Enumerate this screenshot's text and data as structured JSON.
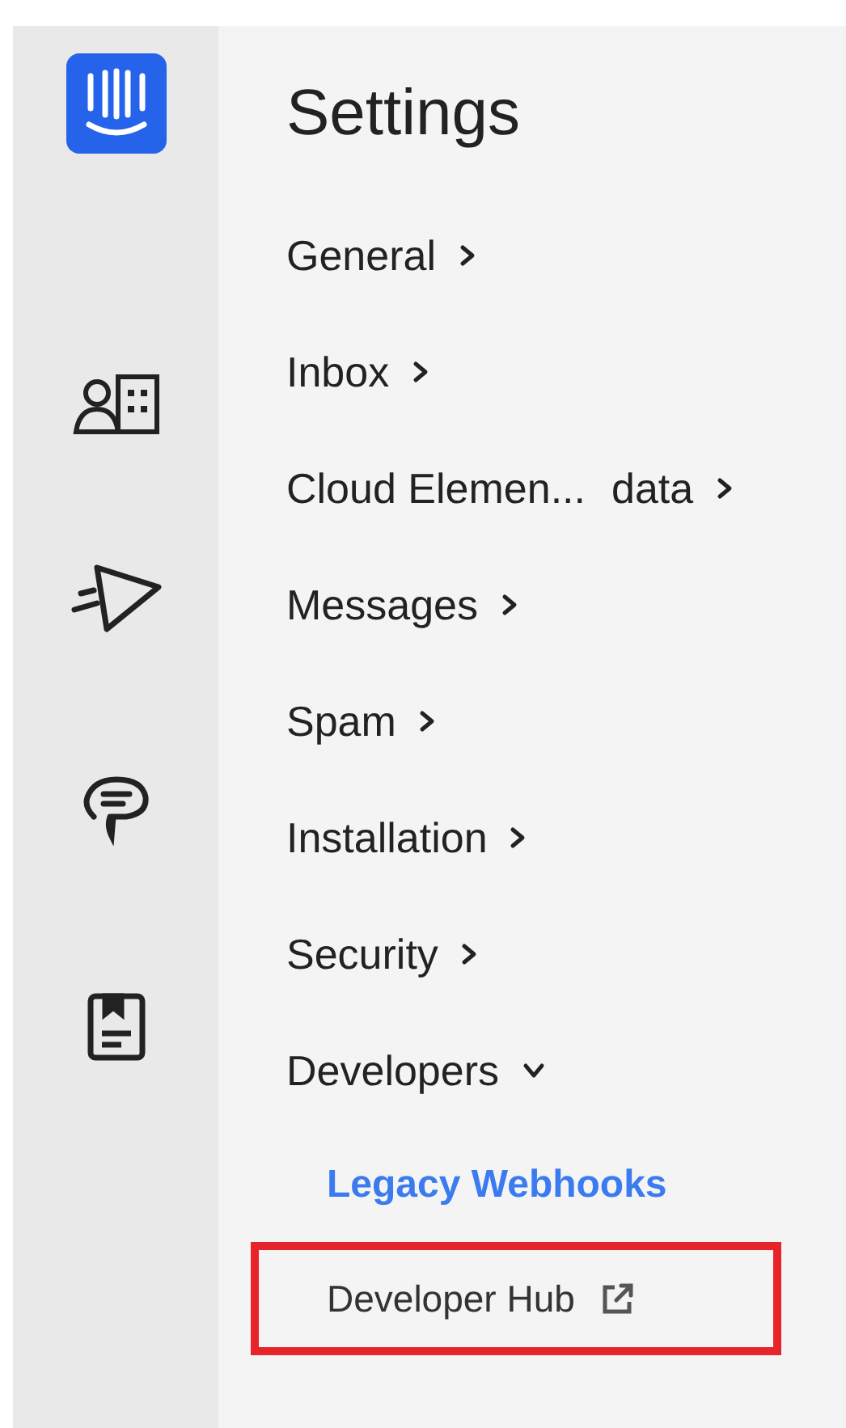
{
  "rail": {
    "items": [
      {
        "kind": "logo"
      },
      {
        "kind": "contacts"
      },
      {
        "kind": "outbound"
      },
      {
        "kind": "chat"
      },
      {
        "kind": "articles"
      }
    ]
  },
  "title": "Settings",
  "menu": [
    {
      "label": "General",
      "expanded": false
    },
    {
      "label": "Inbox",
      "expanded": false
    },
    {
      "label": "Cloud Elemen...",
      "suffix": "data",
      "expanded": false
    },
    {
      "label": "Messages",
      "expanded": false
    },
    {
      "label": "Spam",
      "expanded": false
    },
    {
      "label": "Installation",
      "expanded": false
    },
    {
      "label": "Security",
      "expanded": false
    },
    {
      "label": "Developers",
      "expanded": true,
      "children": [
        {
          "label": "Legacy Webhooks",
          "selected": true,
          "external": false,
          "highlighted": false
        },
        {
          "label": "Developer Hub",
          "selected": false,
          "external": true,
          "highlighted": true
        }
      ]
    }
  ]
}
